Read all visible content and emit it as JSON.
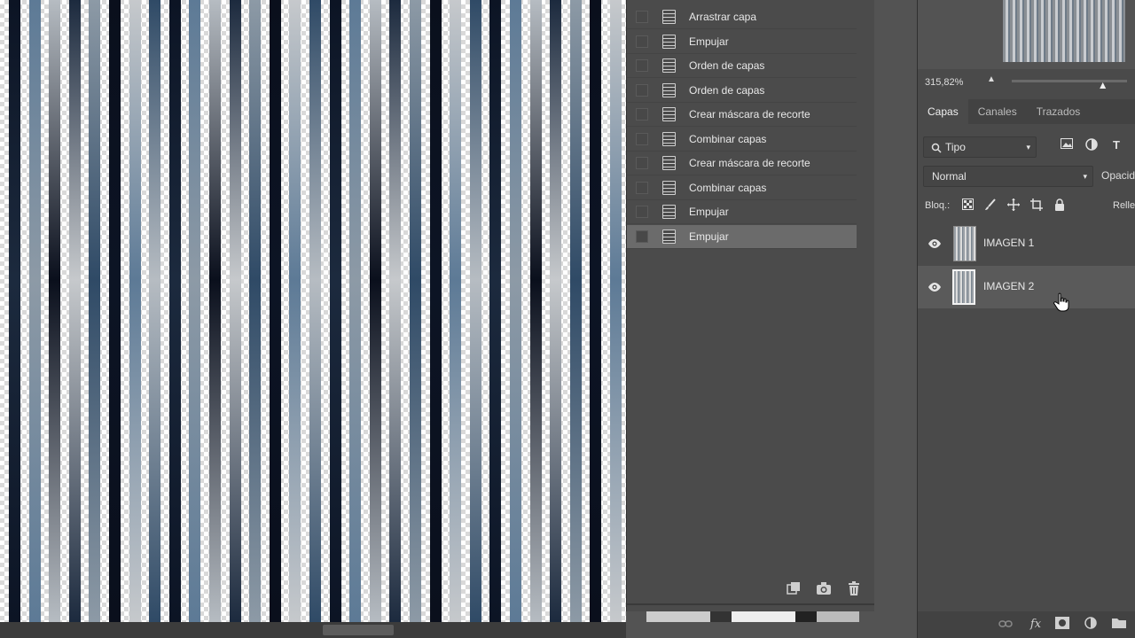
{
  "history": {
    "items": [
      {
        "label": "Arrastrar capa",
        "selected": false
      },
      {
        "label": "Empujar",
        "selected": false
      },
      {
        "label": "Orden de capas",
        "selected": false
      },
      {
        "label": "Orden de capas",
        "selected": false
      },
      {
        "label": "Crear máscara de recorte",
        "selected": false
      },
      {
        "label": "Combinar capas",
        "selected": false
      },
      {
        "label": "Crear máscara de recorte",
        "selected": false
      },
      {
        "label": "Combinar capas",
        "selected": false
      },
      {
        "label": "Empujar",
        "selected": false
      },
      {
        "label": "Empujar",
        "selected": true
      }
    ],
    "footer_icons": [
      "new-document-from-state-icon",
      "camera-snapshot-icon",
      "trash-icon"
    ]
  },
  "navigator": {
    "zoom": "315,82%",
    "zoom_slider_level": 0.79
  },
  "layers_panel": {
    "tabs": [
      {
        "label": "Capas",
        "active": true
      },
      {
        "label": "Canales",
        "active": false
      },
      {
        "label": "Trazados",
        "active": false
      }
    ],
    "filter_label": "Tipo",
    "blend_mode": "Normal",
    "opacity_label": "Opacidad",
    "lock_label": "Bloq.:",
    "fill_label": "Relleno",
    "layers": [
      {
        "name": "IMAGEN 1",
        "visible": true,
        "selected": false
      },
      {
        "name": "IMAGEN 2",
        "visible": true,
        "selected": true
      }
    ]
  },
  "colors": {
    "panel_bg": "#4b4b4b",
    "selected_row": "#6b6b6b",
    "canvas_stripe_blue": "#2a4a6a",
    "canvas_stripe_navy": "#0c1424"
  }
}
